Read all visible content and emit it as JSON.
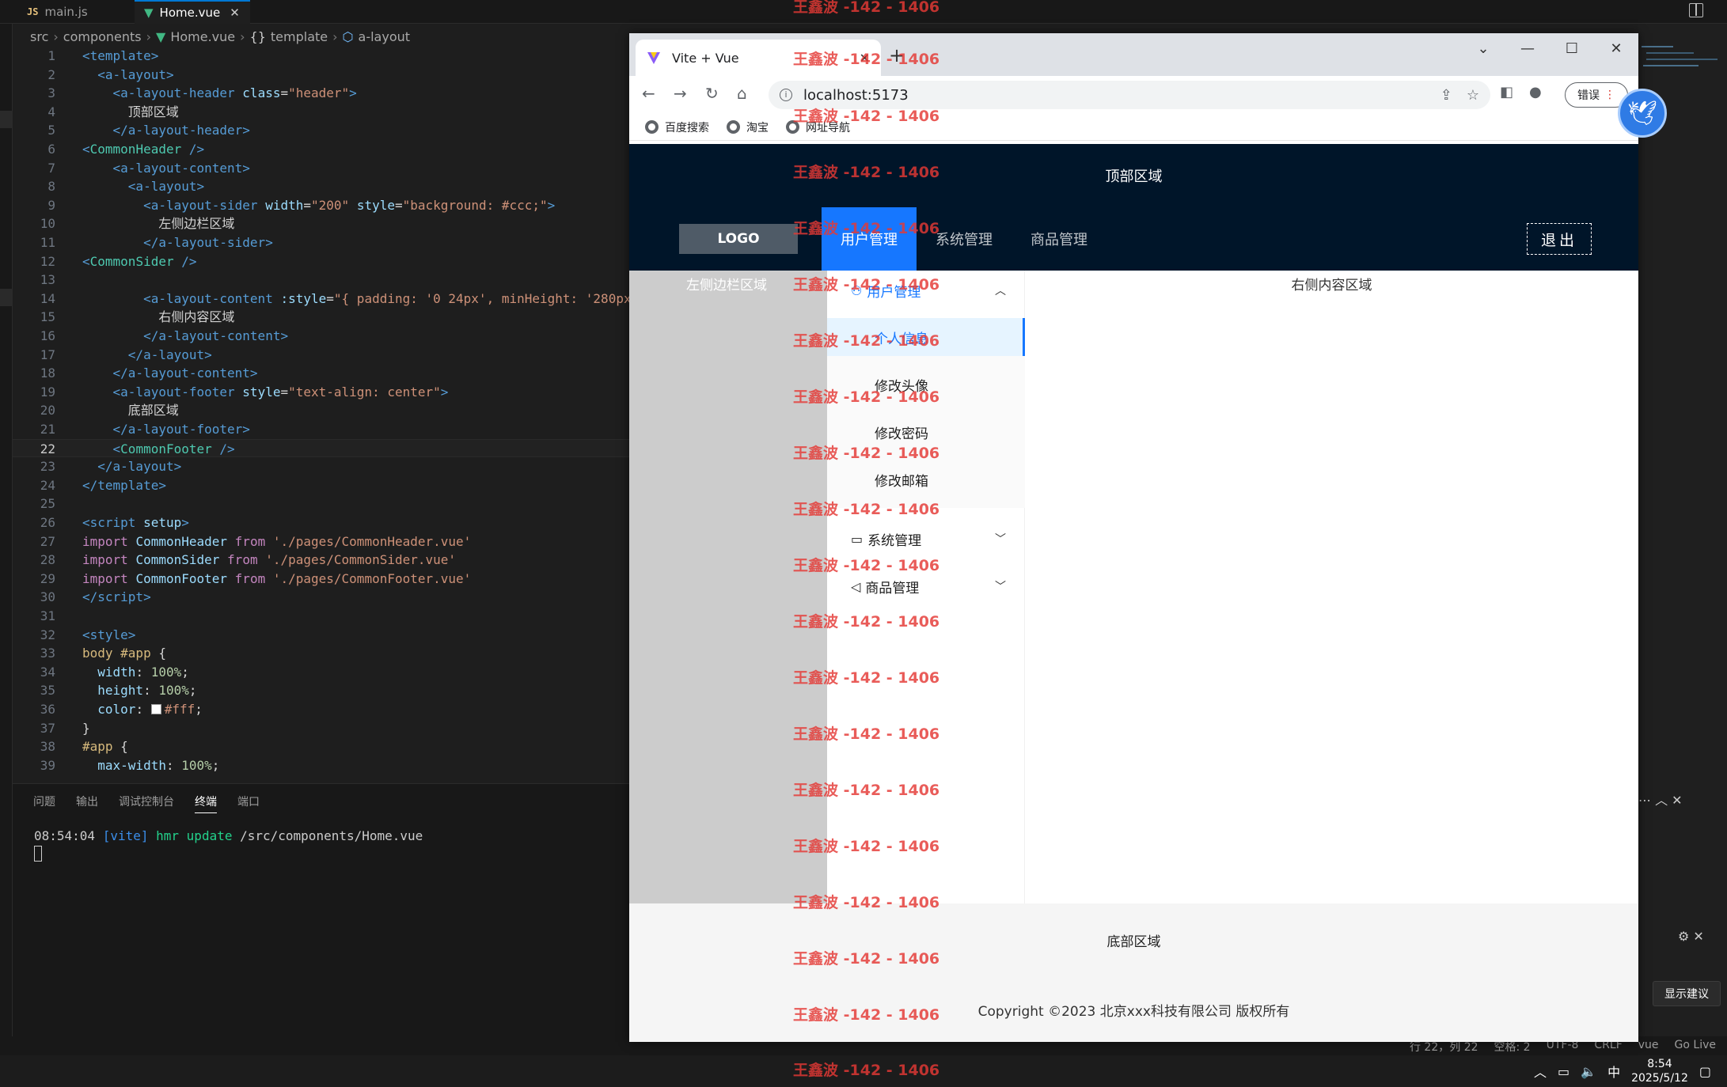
{
  "editor": {
    "tabs": [
      {
        "label": "main.js",
        "lang": "JS"
      },
      {
        "label": "Home.vue",
        "close": "✕"
      }
    ],
    "breadcrumb": [
      "src",
      "components",
      "Home.vue",
      "template",
      "a-layout"
    ],
    "code_lines": [
      "1",
      "2",
      "3",
      "4",
      "5",
      "6",
      "7",
      "8",
      "9",
      "10",
      "11",
      "12",
      "13",
      "14",
      "15",
      "16",
      "17",
      "18",
      "19",
      "20",
      "21",
      "22",
      "23",
      "24",
      "25",
      "26",
      "27",
      "28",
      "29",
      "30",
      "31",
      "32",
      "33",
      "34",
      "35",
      "36",
      "37",
      "38",
      "39"
    ],
    "current_line": "22",
    "code_text": {
      "l10": "左侧边栏区域",
      "l4": "顶部区域",
      "l15": "右侧内容区域",
      "l20": "底部区域"
    },
    "panel_tabs": [
      "问题",
      "输出",
      "调试控制台",
      "终端",
      "端口"
    ],
    "terminal": {
      "time": "08:54:04",
      "tag": "[vite]",
      "cmd": "hmr update",
      "path": "/src/components/Home.vue"
    },
    "suggest_button": "显示建议",
    "statusbar": [
      "行 22，列 22",
      "空格: 2",
      "UTF-8",
      "CRLF",
      "vue",
      "Go Live"
    ],
    "clock": {
      "time": "8:54",
      "date": "2025/5/12"
    },
    "ime": "中"
  },
  "browser": {
    "tab_title": "Vite + Vue",
    "tab_close": "✕",
    "new_tab": "+",
    "url": "localhost:5173",
    "error_button": "错误",
    "bookmarks": [
      "百度搜索",
      "淘宝",
      "网址导航"
    ]
  },
  "app": {
    "top_area": "顶部区域",
    "logo": "LOGO",
    "nav": [
      "用户管理",
      "系统管理",
      "商品管理"
    ],
    "logout": "退出",
    "sider_area": "左侧边栏区域",
    "menu": {
      "user": "用户管理",
      "user_sub": [
        "个人信息",
        "修改头像",
        "修改密码",
        "修改邮箱"
      ],
      "system": "系统管理",
      "goods": "商品管理"
    },
    "content_area": "右侧内容区域",
    "footer_area": "底部区域",
    "copyright": "Copyright ©2023 北京xxx科技有限公司 版权所有"
  },
  "watermark": "王鑫波 -142 - 1406"
}
